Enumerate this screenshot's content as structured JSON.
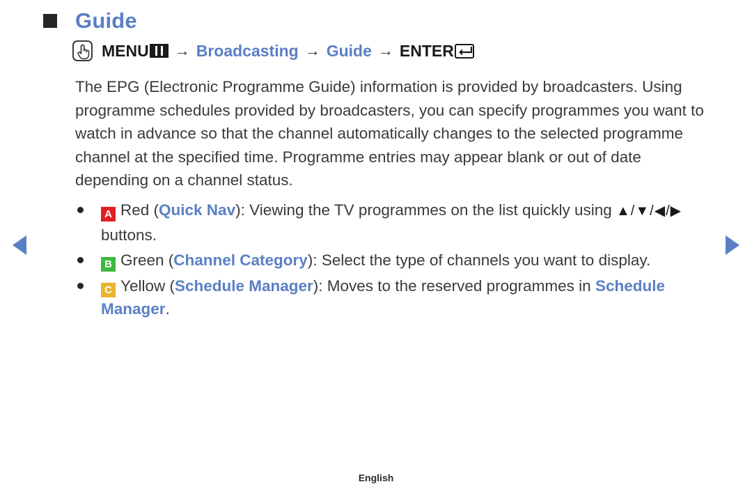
{
  "colors": {
    "accent_blue": "#5a7fc4",
    "text_dark": "#3a3a3a",
    "badge_red": "#e02020",
    "badge_green": "#3fb83f",
    "badge_yellow": "#eab330"
  },
  "nav": {
    "prev_icon": "triangle-left-icon",
    "next_icon": "triangle-right-icon"
  },
  "heading": {
    "marker_icon": "square-bullet-icon",
    "title": "Guide"
  },
  "path": {
    "touch_icon": "hand-touch-icon",
    "menu_label": "MENU",
    "menu_icon": "menu-grid-icon",
    "separator": "→",
    "item1": "Broadcasting",
    "item2": "Guide",
    "enter_label": "ENTER",
    "enter_icon": "enter-key-icon"
  },
  "body": {
    "paragraph": "The EPG (Electronic Programme Guide) information is provided by broadcasters. Using programme schedules provided by broadcasters, you can specify programmes you want to watch in advance so that the channel automatically changes to the selected programme channel at the specified time. Programme entries may appear blank or out of date depending on a channel status."
  },
  "bullets": [
    {
      "badge": "A",
      "badge_color": "#e02020",
      "text_before": "Red (",
      "highlight": "Quick Nav",
      "text_after": "): Viewing the TV programmes on the list quickly using ",
      "glyphs": "▲/▼/◀/▶",
      "text_tail": " buttons."
    },
    {
      "badge": "B",
      "badge_color": "#3fb83f",
      "text_before": "Green (",
      "highlight": "Channel Category",
      "text_after": "): Select the type of channels you want to display.",
      "glyphs": "",
      "text_tail": ""
    },
    {
      "badge": "C",
      "badge_color": "#eab330",
      "text_before": "Yellow (",
      "highlight": "Schedule Manager",
      "text_after": "): Moves to the reserved programmes in ",
      "highlight2": "Schedule Manager",
      "text_tail": "."
    }
  ],
  "footer": {
    "language": "English"
  }
}
